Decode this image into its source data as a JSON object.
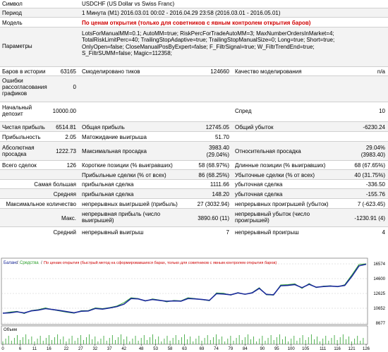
{
  "header": {
    "symbol_label": "Символ",
    "symbol_value": "USDCHF (US Dollar vs Swiss Franc)",
    "period_label": "Период",
    "period_value": "1 Минута (M1) 2016.03.01 00:02 - 2016.04.29 23:58 (2016.03.01 - 2016.05.01)",
    "model_label": "Модель",
    "model_value": "По ценам открытия (только для советников с явным контролем открытия баров)",
    "params_label": "Параметры",
    "params_lines": [
      "LotsForManualMM=0.1; AutoMM=true; RiskPercForTradeAutoMM=3; MaxNumberOrdersInMarket=4;",
      "TotalRiskLimitPerc=40; TrailingStopAdaptive=true; TrailingStopManualSize=0; Long=true; Short=true;",
      "OnlyOpen=false; CloseManualPosByExpert=false; F_FiltrSignal=true; W_FiltrTrendEnd=true;",
      "S_FiltrSUMM=false; Magic=112358;"
    ]
  },
  "stats": {
    "bars_label": "Баров в истории",
    "bars_value": "63165",
    "ticks_label": "Смоделировано тиков",
    "ticks_value": "124660",
    "quality_label": "Качество моделирования",
    "quality_value": "n/a",
    "errors_label": "Ошибки рассогласования графиков",
    "errors_value": "0",
    "deposit_label": "Начальный депозит",
    "deposit_value": "10000.00",
    "spread_label": "Спред",
    "spread_value": "10",
    "net_label": "Чистая прибыль",
    "net_value": "6514.81",
    "gross_profit_label": "Общая прибыль",
    "gross_profit_value": "12745.05",
    "gross_loss_label": "Общий убыток",
    "gross_loss_value": "-6230.24",
    "pf_label": "Прибыльность",
    "pf_value": "2.05",
    "ep_label": "Матожидание выигрыша",
    "ep_value": "51.70",
    "abs_dd_label": "Абсолютная просадка",
    "abs_dd_value": "1222.73",
    "max_dd_label": "Максимальная просадка",
    "max_dd_value1": "3983.40",
    "max_dd_value2": "(29.04%)",
    "rel_dd_label": "Относительная просадка",
    "rel_dd_value1": "29.04%",
    "rel_dd_value2": "(3983.40)",
    "trades_label": "Всего сделок",
    "trades_value": "126",
    "short_label": "Короткие позиции (% выигравших)",
    "short_value": "58 (68.97%)",
    "long_label": "Длинные позиции (% выигравших)",
    "long_value": "68 (67.65%)",
    "profit_trades_label": "Прибыльные сделки (% от всех)",
    "profit_trades_value": "86 (68.25%)",
    "loss_trades_label": "Убыточные сделки (% от всех)",
    "loss_trades_value": "40 (31.75%)",
    "largest_label": "Самая большая",
    "largest_profit_label": "прибыльная сделка",
    "largest_profit_value": "1111.66",
    "largest_loss_label": "убыточная сделка",
    "largest_loss_value": "-336.50",
    "average_label": "Средняя",
    "avg_profit_label": "прибыльная сделка",
    "avg_profit_value": "148.20",
    "avg_loss_label": "убыточная сделка",
    "avg_loss_value": "-155.76",
    "max_label": "Максимальное количество",
    "max_wins_label": "непрерывных выигрышей (прибыль)",
    "max_wins_value": "27 (3032.94)",
    "max_losses_label": "непрерывных проигрышей (убыток)",
    "max_losses_value": "7 (-623.45)",
    "maximal_label": "Макс.",
    "maximal_profit_label": "непрерывная прибыль (число выигрышей)",
    "maximal_profit_value": "3890.60 (11)",
    "maximal_loss_label": "непрерывный убыток (число проигрышей)",
    "maximal_loss_value": "-1230.91 (4)",
    "avg_cons_label": "Средний",
    "avg_wins_label": "непрерывный выигрыш",
    "avg_wins_value": "7",
    "avg_losses_label": "непрерывный проигрыш",
    "avg_losses_value": "4"
  },
  "chart_data": {
    "type": "line",
    "legend": [
      "Баланс",
      "Средства",
      "По ценам открытия (быстрый метод на сформировавшихся барах, только для советников с явным контролем открытия баров)"
    ],
    "legend_colors": [
      "#1a2a9a",
      "#2aa02a",
      "#d00000"
    ],
    "yticks": [
      "16574",
      "14600",
      "12625",
      "10652",
      "8677"
    ],
    "ylim": [
      8677,
      16574
    ],
    "xticks": [
      "0",
      "6",
      "11",
      "16",
      "22",
      "27",
      "32",
      "37",
      "42",
      "48",
      "53",
      "58",
      "63",
      "69",
      "74",
      "79",
      "84",
      "90",
      "95",
      "100",
      "105",
      "111",
      "116",
      "121",
      "126"
    ],
    "volume_label": "Объем",
    "balance": [
      10000,
      10050,
      10180,
      10020,
      10300,
      10410,
      10600,
      10480,
      10350,
      10200,
      10050,
      10260,
      10290,
      10620,
      10540,
      10690,
      10880,
      11200,
      11950,
      11900,
      11650,
      11820,
      11700,
      11580,
      11630,
      11600,
      11950,
      11900,
      11820,
      11700,
      12600,
      12550,
      12450,
      12700,
      12520,
      12700,
      13300,
      12500,
      12450,
      13650,
      13700,
      13800,
      13400,
      13850,
      13450,
      13550,
      13600,
      13550,
      13700,
      14900,
      16300,
      16520
    ],
    "equity": [
      10000,
      10150,
      10250,
      9950,
      10350,
      10480,
      10700,
      10450,
      10280,
      10120,
      9980,
      10320,
      10350,
      10700,
      10600,
      10750,
      10950,
      11400,
      12050,
      11950,
      11600,
      11900,
      11750,
      11500,
      11700,
      11650,
      12050,
      11950,
      11800,
      11650,
      12700,
      12650,
      12400,
      12750,
      12500,
      12750,
      13400,
      12450,
      12400,
      13750,
      13800,
      13900,
      13300,
      13950,
      13400,
      13600,
      13650,
      13500,
      13800,
      15100,
      16500,
      16574
    ]
  }
}
